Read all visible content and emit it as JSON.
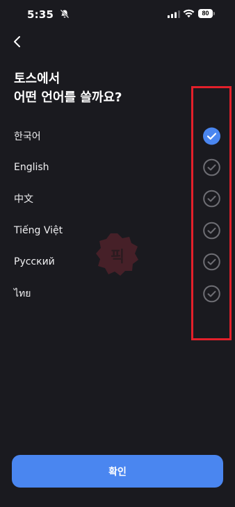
{
  "status_bar": {
    "time": "5:35",
    "battery": "80"
  },
  "header": {
    "back_icon": "chevron-left-icon",
    "title_line1": "토스에서",
    "title_line2": "어떤 언어를 쓸까요?"
  },
  "languages": [
    {
      "label": "한국어",
      "selected": true
    },
    {
      "label": "English",
      "selected": false
    },
    {
      "label": "中文",
      "selected": false
    },
    {
      "label": "Tiếng Việt",
      "selected": false
    },
    {
      "label": "Русский",
      "selected": false
    },
    {
      "label": "ไทย",
      "selected": false
    }
  ],
  "watermark": {
    "text": "픽"
  },
  "footer": {
    "confirm_label": "확인"
  },
  "colors": {
    "background": "#1a1a1f",
    "accent": "#4a86f0",
    "check_inactive": "#6e6e74",
    "highlight": "#e3202a"
  }
}
